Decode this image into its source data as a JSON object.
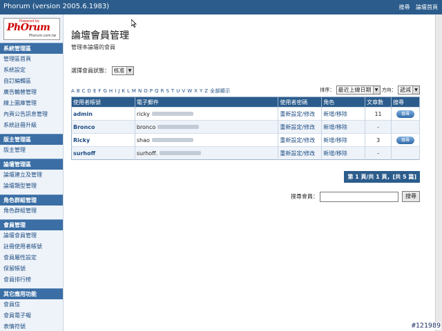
{
  "app": {
    "title": "Phorum (version 2005.6.1983)",
    "top_links": [
      "搜尋",
      "論壇首頁"
    ]
  },
  "logo": {
    "powered": "Powered by",
    "name": "PhOrum",
    "url": "Phorum.com.tw"
  },
  "sidebar": {
    "groups": [
      {
        "header": "系統管理區",
        "items": [
          "管理區首頁",
          "系統設定",
          "自訂編輯區",
          "廣告輪替管理",
          "線上圖庫管理",
          "內頁公告訊息管理",
          "系統註冊升級"
        ]
      },
      {
        "header": "版主管理區",
        "items": [
          "版主管理"
        ]
      },
      {
        "header": "論壇管理區",
        "items": [
          "論壇建立及管理",
          "論壇類型管理"
        ]
      },
      {
        "header": "角色群組管理",
        "items": [
          "角色群組管理"
        ]
      },
      {
        "header": "會員管理",
        "items": [
          "論壇會員管理",
          "註冊使用者帳號",
          "會員屬性設定",
          "保留帳號",
          "會員排行榜"
        ]
      },
      {
        "header": "其它應用功能",
        "items": [
          "會員信",
          "會員電子報",
          "表情符號"
        ]
      }
    ]
  },
  "main": {
    "title": "論壇會員管理",
    "subtitle": "管理本論壇的會員",
    "status_label": "選擇會員狀態：",
    "status_value": "核准",
    "alphabet": "A B C D E F G H I J K L M N O P Q R S T U V W X Y Z 全部顯示",
    "sort_label": "排序：",
    "sort_value": "最近上線日期",
    "direction_label": "方向：",
    "direction_value": "遞減",
    "columns": [
      "使用者帳號",
      "電子郵件",
      "使用者密碼",
      "角色",
      "文章數",
      "搜尋"
    ],
    "rows": [
      {
        "username": "admin",
        "email": "ricky",
        "password": "重新設定/修改",
        "role": "新增/移除",
        "posts": "11",
        "search": "搜尋"
      },
      {
        "username": "Bronco",
        "email": "bronco",
        "password": "重新設定/修改",
        "role": "新增/移除",
        "posts": "-",
        "search": ""
      },
      {
        "username": "Ricky",
        "email": "shao",
        "password": "重新設定/修改",
        "role": "新增/移除",
        "posts": "3",
        "search": "搜尋"
      },
      {
        "username": "surhoff",
        "email": "surhoff.",
        "password": "重新設定/修改",
        "role": "新增/移除",
        "posts": "-",
        "search": ""
      }
    ],
    "pager": "第 1 頁/共 1 頁，[共 5 篇]",
    "search_member_label": "搜尋會員：",
    "search_member_value": "",
    "search_button": "搜尋"
  },
  "footer_id": "#121989"
}
